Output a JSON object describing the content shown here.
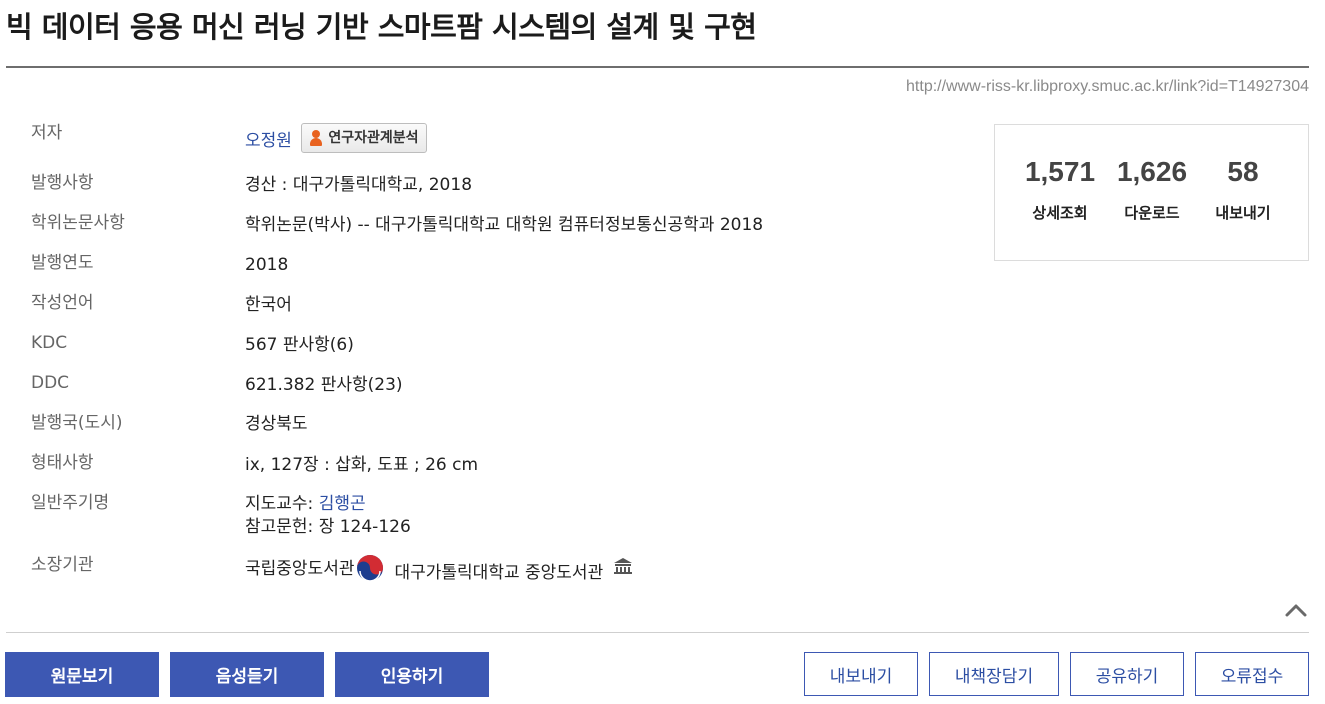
{
  "title": "빅 데이터 응용 머신 러닝 기반 스마트팜 시스템의 설계 및 구현",
  "link_url": "http://www-riss-kr.libproxy.smuc.ac.kr/link?id=T14927304",
  "meta": {
    "author": {
      "label": "저자",
      "value": "오정원",
      "analysis_button": "연구자관계분석"
    },
    "publication": {
      "label": "발행사항",
      "value": "경산 : 대구가톨릭대학교, 2018"
    },
    "thesis": {
      "label": "학위논문사항",
      "value": "학위논문(박사) -- 대구가톨릭대학교 대학원 컴퓨터정보통신공학과 2018"
    },
    "year": {
      "label": "발행연도",
      "value": "2018"
    },
    "language": {
      "label": "작성언어",
      "value": "한국어"
    },
    "kdc": {
      "label": "KDC",
      "value": "567 판사항(6)"
    },
    "ddc": {
      "label": "DDC",
      "value": "621.382 판사항(23)"
    },
    "country": {
      "label": "발행국(도시)",
      "value": "경상북도"
    },
    "physical": {
      "label": "형태사항",
      "value": "ix, 127장 : 삽화, 도표 ; 26 cm"
    },
    "notes": {
      "label": "일반주기명",
      "advisor_prefix": "지도교수: ",
      "advisor": "김행곤",
      "references": "참고문헌: 장 124-126"
    },
    "holdings": {
      "label": "소장기관",
      "library1": "국립중앙도서관",
      "library2": "대구가톨릭대학교 중앙도서관"
    }
  },
  "stats": [
    {
      "value": "1,571",
      "label": "상세조회"
    },
    {
      "value": "1,626",
      "label": "다운로드"
    },
    {
      "value": "58",
      "label": "내보내기"
    }
  ],
  "buttons": {
    "view_original": "원문보기",
    "listen_audio": "음성듣기",
    "cite": "인용하기",
    "export": "내보내기",
    "bookshelf": "내책장담기",
    "share": "공유하기",
    "report_error": "오류접수"
  },
  "colors": {
    "primary": "#3d58b3",
    "link": "#2c4ea3",
    "accent_person": "#e8621f"
  },
  "icons": {
    "analysis": "person-icon",
    "holding1": "korea-emblem-icon",
    "holding2": "library-building-icon",
    "collapse": "chevron-up-icon"
  }
}
